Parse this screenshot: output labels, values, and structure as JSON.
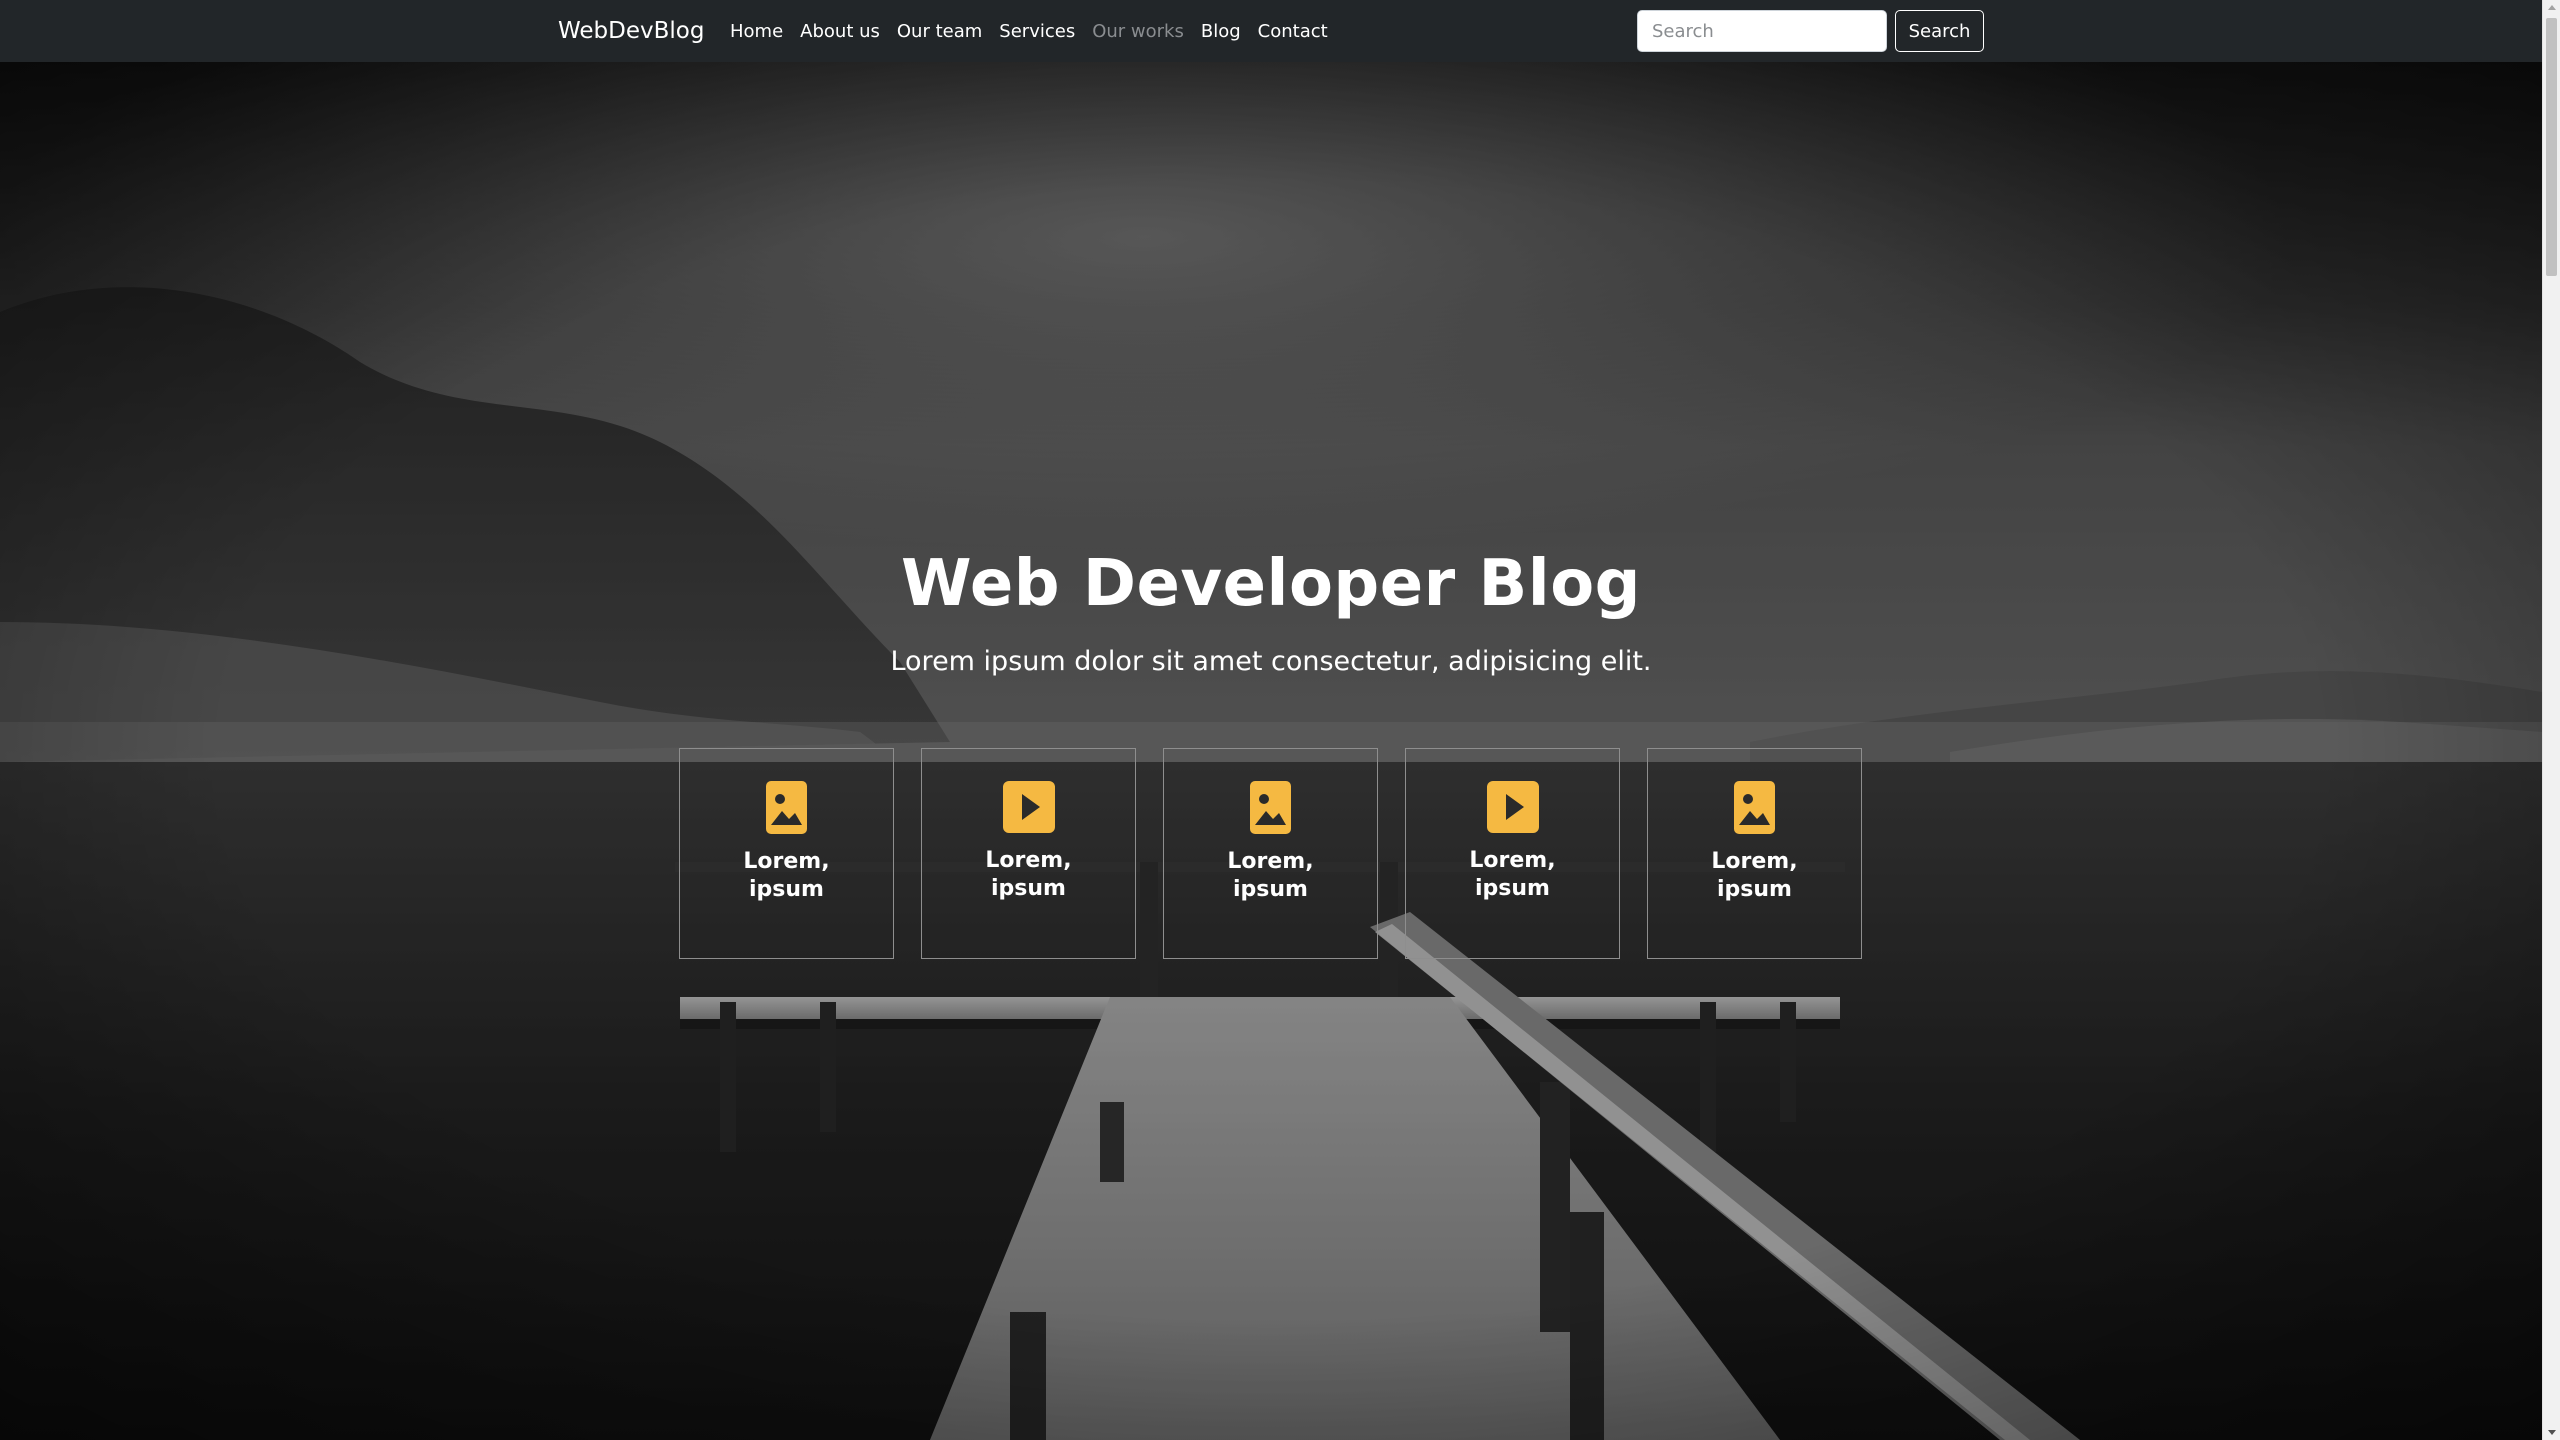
{
  "navbar": {
    "brand": "WebDevBlog",
    "links": [
      "Home",
      "About us",
      "Our team",
      "Services",
      "Our works",
      "Blog",
      "Contact"
    ],
    "search_placeholder": "Search",
    "search_button": "Search"
  },
  "hero": {
    "title": "Web Developer Blog",
    "subtitle": "Lorem ipsum dolor sit amet consectetur, adipisicing elit.",
    "cards": [
      {
        "icon": "image-icon",
        "label": "Lorem, ipsum"
      },
      {
        "icon": "play-icon",
        "label": "Lorem, ipsum"
      },
      {
        "icon": "image-icon",
        "label": "Lorem, ipsum"
      },
      {
        "icon": "play-icon",
        "label": "Lorem, ipsum"
      },
      {
        "icon": "image-icon",
        "label": "Lorem, ipsum"
      }
    ]
  },
  "colors": {
    "navbar_bg": "#222629",
    "accent_icon": "#f5b942",
    "muted_link": "#8a8d90"
  }
}
